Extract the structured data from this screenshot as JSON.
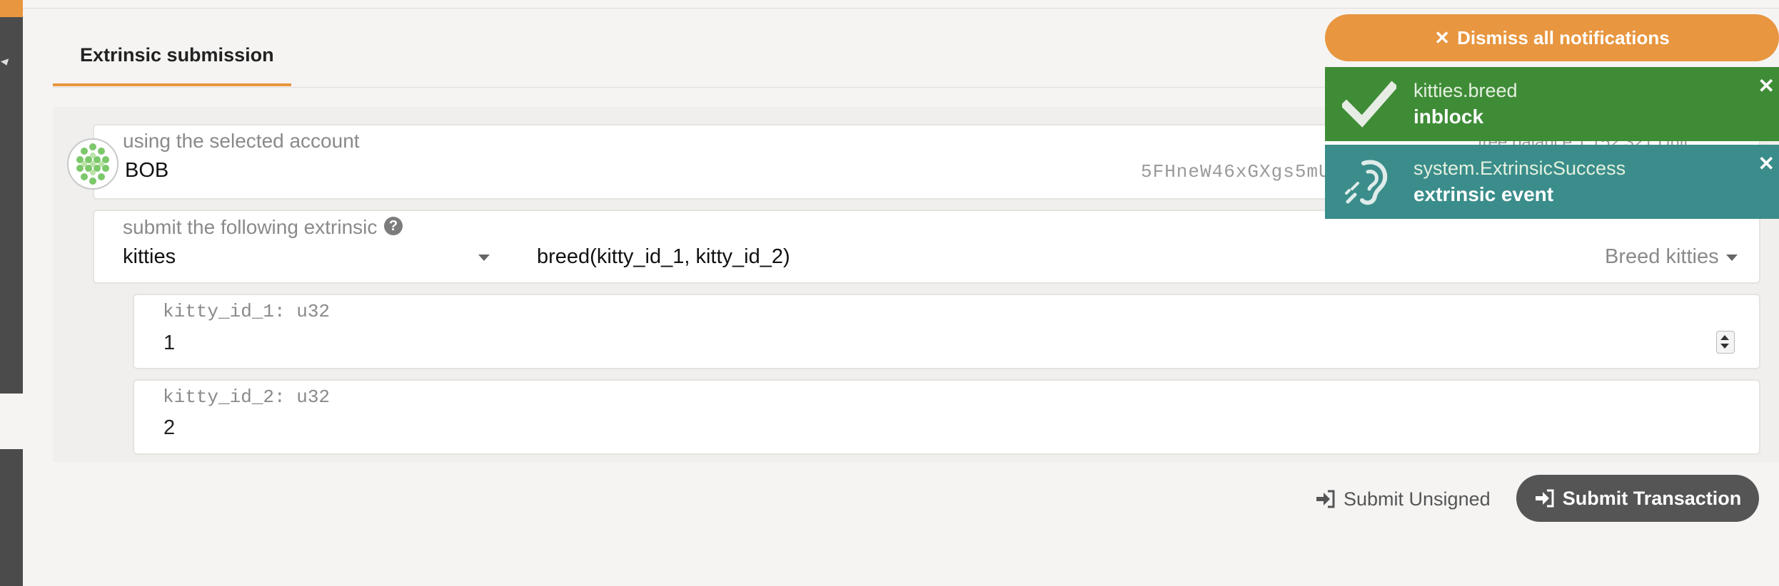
{
  "tabs": [
    {
      "label": "Extrinsic submission",
      "active": true
    }
  ],
  "account": {
    "label": "using the selected account",
    "name": "BOB",
    "address": "5FHneW46xGXgs5mU",
    "balance_partial": "free balance 1.152 321 Unit"
  },
  "extrinsic": {
    "label": "submit the following extrinsic",
    "section": "kitties",
    "method": "breed(kitty_id_1, kitty_id_2)",
    "doc": "Breed kitties"
  },
  "params": [
    {
      "label": "kitty_id_1: u32",
      "value": "1"
    },
    {
      "label": "kitty_id_2: u32",
      "value": "2"
    }
  ],
  "actions": {
    "unsigned_label": "Submit Unsigned",
    "submit_label": "Submit Transaction"
  },
  "notifications": {
    "dismiss_all_label": "Dismiss all notifications",
    "items": [
      {
        "title": "kitties.breed",
        "status": "inblock",
        "icon": "check-icon",
        "color": "#3f8c37"
      },
      {
        "title": "system.ExtrinsicSuccess",
        "status": "extrinsic event",
        "icon": "hearing-icon",
        "color": "#3a8d8a"
      }
    ]
  },
  "colors": {
    "accent": "#e8963f",
    "sidebar": "#4b4b4b",
    "button_dark": "#555555"
  }
}
